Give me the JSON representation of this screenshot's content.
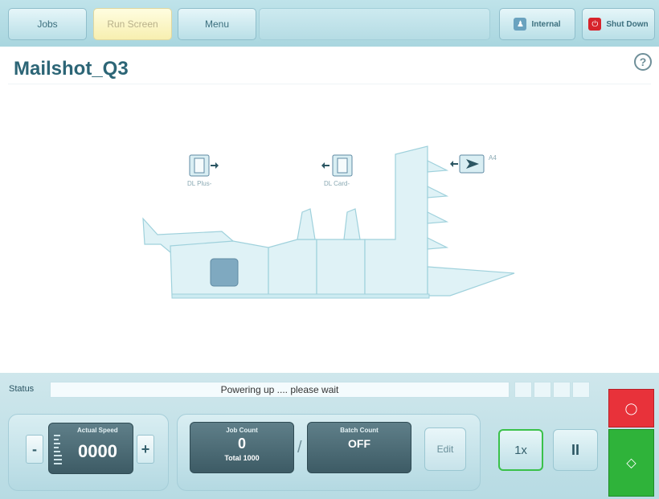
{
  "topbar": {
    "jobs_label": "Jobs",
    "run_screen_label": "Run Screen",
    "menu_label": "Menu",
    "internal_label": "Internal",
    "shutdown_label": "Shut Down"
  },
  "page": {
    "title": "Mailshot_Q3",
    "help_symbol": "?"
  },
  "machine": {
    "feeder_left_label": "DL Plus-",
    "feeder_mid_label": "DL Card-",
    "feeder_right_label": "A4"
  },
  "status": {
    "label": "Status",
    "message": "Powering up .... please wait"
  },
  "speed": {
    "title": "Actual Speed",
    "value": "0000",
    "minus": "-",
    "plus": "+"
  },
  "counts": {
    "job_title": "Job Count",
    "job_value": "0",
    "job_total": "Total 1000",
    "separator": "/",
    "batch_title": "Batch Count",
    "batch_value": "OFF",
    "edit_label": "Edit"
  },
  "controls": {
    "single_cycle_label": "1x",
    "pause_symbol": "II"
  },
  "colors": {
    "accent": "#2c6576",
    "stop": "#e8323a",
    "start": "#2fb33a",
    "active_tab": "#f7efb0"
  }
}
